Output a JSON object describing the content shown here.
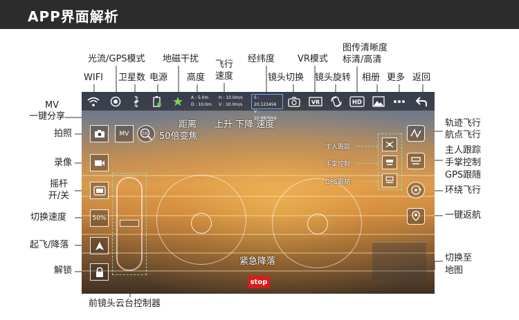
{
  "header": {
    "title": "APP界面解析"
  },
  "labels": {
    "optical_flow_gps": "光流/GPS模式",
    "compass_calib": "地磁干扰",
    "flight_speed_1": "飞行",
    "flight_speed_2": "速度",
    "lat_lng": "经纬度",
    "vr_mode": "VR模式",
    "image_definition_1": "图传清晰度",
    "image_definition_2": "标清/高清",
    "wifi": "WIFI",
    "satellites": "卫星数",
    "power": "电源",
    "height": "高度",
    "lens_switch": "镜头切换",
    "lens_rotate": "镜头旋转",
    "album": "相册",
    "more": "更多",
    "back": "返回",
    "mv_1": "MV",
    "mv_2": "一键分享",
    "photo": "拍照",
    "video": "录像",
    "joystick_1": "摇杆",
    "joystick_2": "开/关",
    "switch_speed": "切换速度",
    "takeoff_land": "起飞/降落",
    "unlock": "解锁",
    "gimbal_ctrl": "前镜头云台控制器",
    "zoom50": "50倍变焦",
    "distance": "距离",
    "up_down_speed": "上升 下降 速度",
    "emergency": "紧急降落",
    "track_1": "轨迹飞行",
    "track_2": "航点飞行",
    "follow_1": "主人跟踪",
    "follow_2": "手掌控制",
    "follow_3": "GPS跟随",
    "orbit": "环绕飞行",
    "rth": "一键返航",
    "switch_to_1": "切换至",
    "switch_to_2": "地图"
  },
  "screen": {
    "altitude": "A : 5.0m",
    "distance": "D : 10.0m",
    "h_speed": "H : 10.0m/s",
    "v_speed": "V : 10.0m/s",
    "lat": "S : 20.123456",
    "lng": "V : 10.987654",
    "mv_btn": "MV",
    "zoom_btn": "50",
    "speed_btn": "50%",
    "stop_btn": "stop",
    "hd_btn": "HD",
    "vr_btn": "VR",
    "owner_follow": "主人跟踪",
    "palm_control": "手掌控制",
    "gps_follow": "GPS跟随"
  },
  "colors": {
    "accent_dashed": "#82e6d2",
    "stop": "#d71c1c",
    "coord_border": "#6aa9ff",
    "header_bg": "#2c2c2c"
  }
}
